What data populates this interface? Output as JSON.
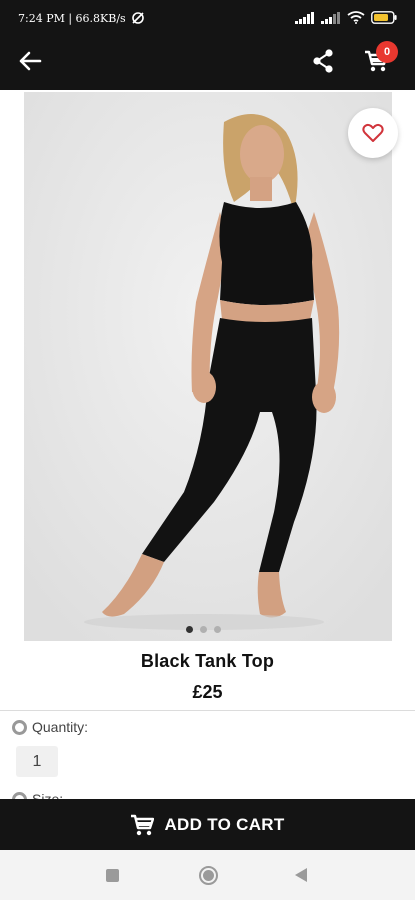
{
  "status_bar": {
    "time_speed": "7:24 PM | 66.8KB/s",
    "icons": [
      "data-saver-icon",
      "signal-icon",
      "signal-icon",
      "wifi-icon",
      "battery-icon"
    ]
  },
  "header": {
    "icons": [
      "back-arrow-icon",
      "share-icon",
      "cart-icon"
    ],
    "cart_count": "0"
  },
  "product": {
    "image_description_icon": "product-photo",
    "favorite_icon": "heart-icon",
    "carousel_dots": 3,
    "carousel_active": 0,
    "title": "Black Tank Top",
    "price": "£25"
  },
  "options": {
    "quantity_label": "Quantity:",
    "quantity_value": "1",
    "size_label_partial": "Size:"
  },
  "action": {
    "add_to_cart_label": "ADD TO CART"
  },
  "colors": {
    "bar": "#141414",
    "badge": "#e8382f",
    "heart": "#d1343b"
  }
}
